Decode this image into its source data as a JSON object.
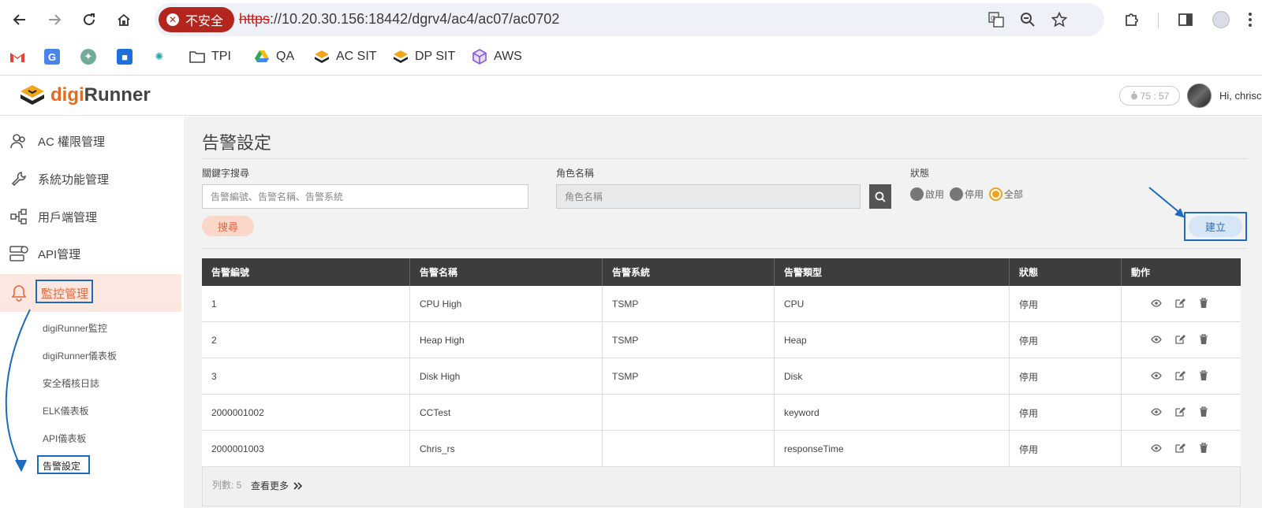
{
  "browser": {
    "insecure_label": "不安全",
    "url_scheme": "https",
    "url_rest": "://10.20.30.156:18442/dgrv4/ac4/ac07/ac0702",
    "bookmarks": [
      {
        "label": "",
        "icon": "gmail-icon"
      },
      {
        "label": "",
        "icon": "translate-icon"
      },
      {
        "label": "",
        "icon": "chatgpt-icon"
      },
      {
        "label": "",
        "icon": "app-icon"
      },
      {
        "label": "",
        "icon": "star-burst-icon"
      },
      {
        "label": "TPI",
        "icon": "folder-icon"
      },
      {
        "label": "QA",
        "icon": "drive-icon"
      },
      {
        "label": "AC SIT",
        "icon": "digirunner-icon"
      },
      {
        "label": "DP SIT",
        "icon": "digirunner-icon"
      },
      {
        "label": "AWS",
        "icon": "cube-icon"
      }
    ]
  },
  "app": {
    "brand_prefix": "digi",
    "brand_suffix": "Runner",
    "timer": "75 : 57",
    "greeting": "Hi, chrisc"
  },
  "sidebar": {
    "items": [
      {
        "label": "AC 權限管理",
        "icon": "users-icon"
      },
      {
        "label": "系統功能管理",
        "icon": "wrench-icon"
      },
      {
        "label": "用戶端管理",
        "icon": "network-icon"
      },
      {
        "label": "API管理",
        "icon": "api-icon"
      },
      {
        "label": "監控管理",
        "icon": "bell-icon"
      }
    ],
    "subitems": [
      "digiRunner監控",
      "digiRunner儀表板",
      "安全稽核日誌",
      "ELK儀表板",
      "API儀表板",
      "告警設定"
    ]
  },
  "page": {
    "title": "告警設定",
    "keyword_label": "關鍵字搜尋",
    "keyword_placeholder": "告警編號、告警名稱、告警系統",
    "role_label": "角色名稱",
    "role_placeholder": "角色名稱",
    "status_label": "狀態",
    "status_options": [
      "啟用",
      "停用",
      "全部"
    ],
    "status_selected": "全部",
    "search_button": "搜尋",
    "create_button": "建立"
  },
  "table": {
    "headers": [
      "告警編號",
      "告警名稱",
      "告警系統",
      "告警類型",
      "狀態",
      "動作"
    ],
    "rows": [
      [
        "1",
        "CPU High",
        "TSMP",
        "CPU",
        "停用"
      ],
      [
        "2",
        "Heap High",
        "TSMP",
        "Heap",
        "停用"
      ],
      [
        "3",
        "Disk High",
        "TSMP",
        "Disk",
        "停用"
      ],
      [
        "2000001002",
        "CCTest",
        "",
        "keyword",
        "停用"
      ],
      [
        "2000001003",
        "Chris_rs",
        "",
        "responseTime",
        "停用"
      ]
    ],
    "row_count_label": "列數: 5",
    "more_label": "查看更多"
  },
  "colors": {
    "accent": "#e8643a",
    "annotation": "#1b6cc0",
    "header_bg": "#3d3d3d"
  }
}
